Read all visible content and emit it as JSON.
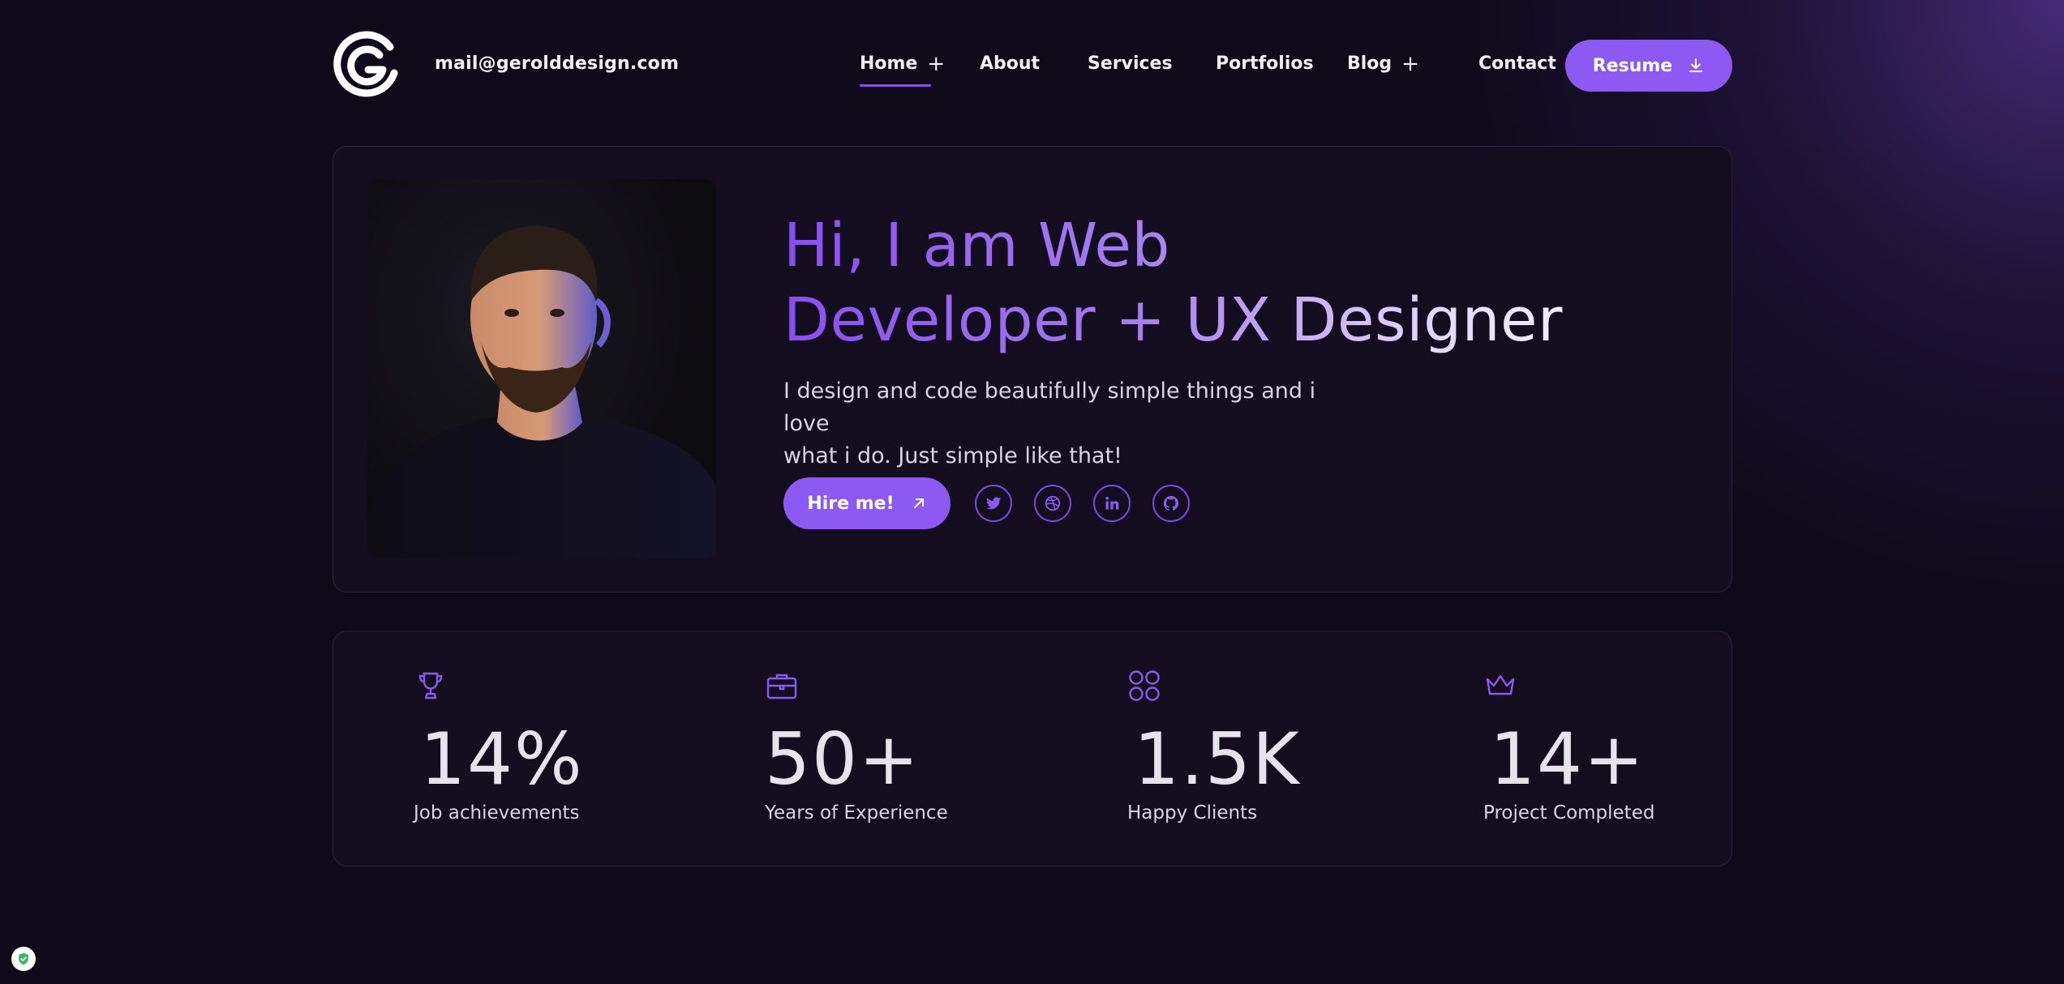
{
  "header": {
    "email": "mail@gerolddesign.com",
    "nav": [
      {
        "label": "Home",
        "has_plus": true,
        "active": true
      },
      {
        "label": "About",
        "has_plus": false
      },
      {
        "label": "Services",
        "has_plus": false
      },
      {
        "label": "Portfolios",
        "has_plus": false
      },
      {
        "label": "Blog",
        "has_plus": true
      },
      {
        "label": "Contact",
        "has_plus": false
      }
    ],
    "plus_symbol": "+",
    "resume_label": "Resume",
    "resume_icon": "download-icon"
  },
  "hero": {
    "title_line1": "Hi, I am Web",
    "title_line2": "Developer + UX Designer",
    "subtitle_line1": "I design and code beautifully simple things and i love",
    "subtitle_line2": "what i do. Just simple like that!",
    "hire_label": "Hire me!",
    "hire_icon": "arrow-up-right-icon",
    "socials": [
      "twitter-icon",
      "dribbble-icon",
      "linkedin-icon",
      "github-icon"
    ]
  },
  "stats": [
    {
      "icon": "trophy-icon",
      "value": "14%",
      "label": "Job achievements"
    },
    {
      "icon": "briefcase-icon",
      "value": "50+",
      "label": "Years of Experience"
    },
    {
      "icon": "grid-circles-icon",
      "value": "1.5K",
      "label": "Happy Clients"
    },
    {
      "icon": "crown-icon",
      "value": "14+",
      "label": "Project Completed"
    }
  ],
  "colors": {
    "background": "#0f0a1a",
    "card": "#130d1f",
    "accent": "#8c5af2",
    "text": "#f1eef7"
  }
}
